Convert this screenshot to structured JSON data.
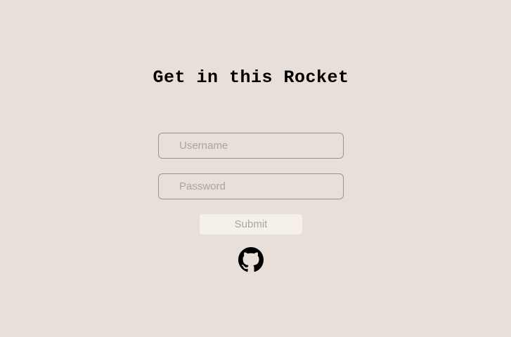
{
  "title": "Get in this Rocket",
  "form": {
    "username_placeholder": "Username",
    "password_placeholder": "Password",
    "submit_label": "Submit"
  },
  "icons": {
    "github": "github-icon"
  },
  "colors": {
    "background": "#e8dfd9",
    "submit_background": "#f5f0e9",
    "field_border": "#9a9593",
    "placeholder_text": "#a9a4a1"
  }
}
